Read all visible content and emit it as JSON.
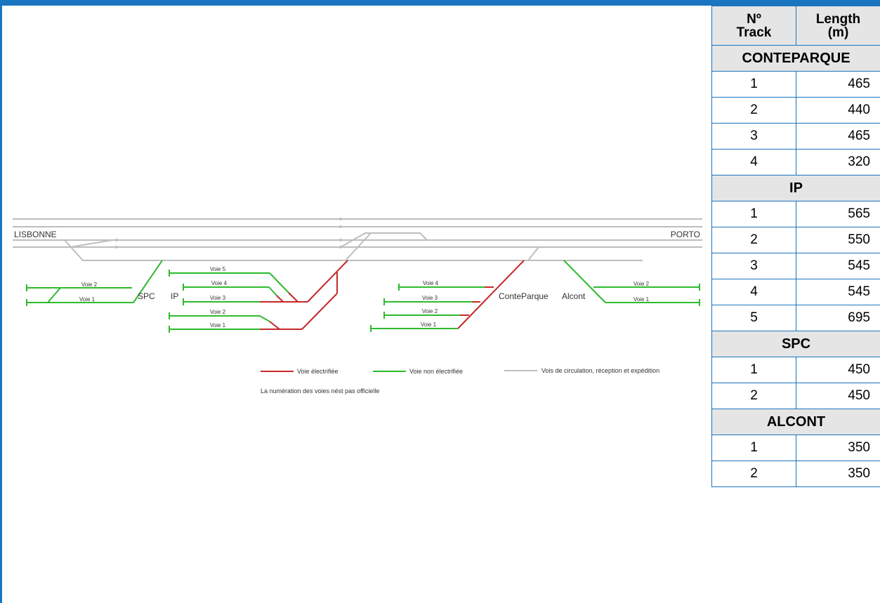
{
  "diagram": {
    "endpoints": {
      "left": "LISBONNE",
      "right": "PORTO"
    },
    "stations": {
      "spc": "SPC",
      "ip": "IP",
      "conteparque": "ConteParque",
      "alcont": "Alcont"
    },
    "track_labels": {
      "spc_2": "Voie 2",
      "spc_1": "Voie 1",
      "ip_5": "Voie 5",
      "ip_4": "Voie 4",
      "ip_3": "Voie 3",
      "ip_2": "Voie 2",
      "ip_1": "Voie 1",
      "cp_4": "Voie 4",
      "cp_3": "Voie 3",
      "cp_2": "Voie 2",
      "cp_1": "Voie 1",
      "al_2": "Voie 2",
      "al_1": "Voie 1"
    },
    "legend": {
      "electrified": "Voie électrifiée",
      "non_electrified": "Voie non électrifiée",
      "circulation": "Vois de circulation, réception et expédition",
      "note": "La numération des voies nést pas officielle"
    },
    "colors": {
      "electrified": "#c62828",
      "non_electrified": "#2dbb2d",
      "circulation": "#bdbdbd"
    }
  },
  "table": {
    "header": {
      "track": [
        "Nº",
        "Track"
      ],
      "length": [
        "Length",
        "(m)"
      ]
    },
    "sections": [
      {
        "name": "CONTEPARQUE",
        "rows": [
          {
            "track": "1",
            "length": "465"
          },
          {
            "track": "2",
            "length": "440"
          },
          {
            "track": "3",
            "length": "465"
          },
          {
            "track": "4",
            "length": "320"
          }
        ]
      },
      {
        "name": "IP",
        "rows": [
          {
            "track": "1",
            "length": "565"
          },
          {
            "track": "2",
            "length": "550"
          },
          {
            "track": "3",
            "length": "545"
          },
          {
            "track": "4",
            "length": "545"
          },
          {
            "track": "5",
            "length": "695"
          }
        ]
      },
      {
        "name": "SPC",
        "rows": [
          {
            "track": "1",
            "length": "450"
          },
          {
            "track": "2",
            "length": "450"
          }
        ]
      },
      {
        "name": "ALCONT",
        "rows": [
          {
            "track": "1",
            "length": "350"
          },
          {
            "track": "2",
            "length": "350"
          }
        ]
      }
    ]
  }
}
